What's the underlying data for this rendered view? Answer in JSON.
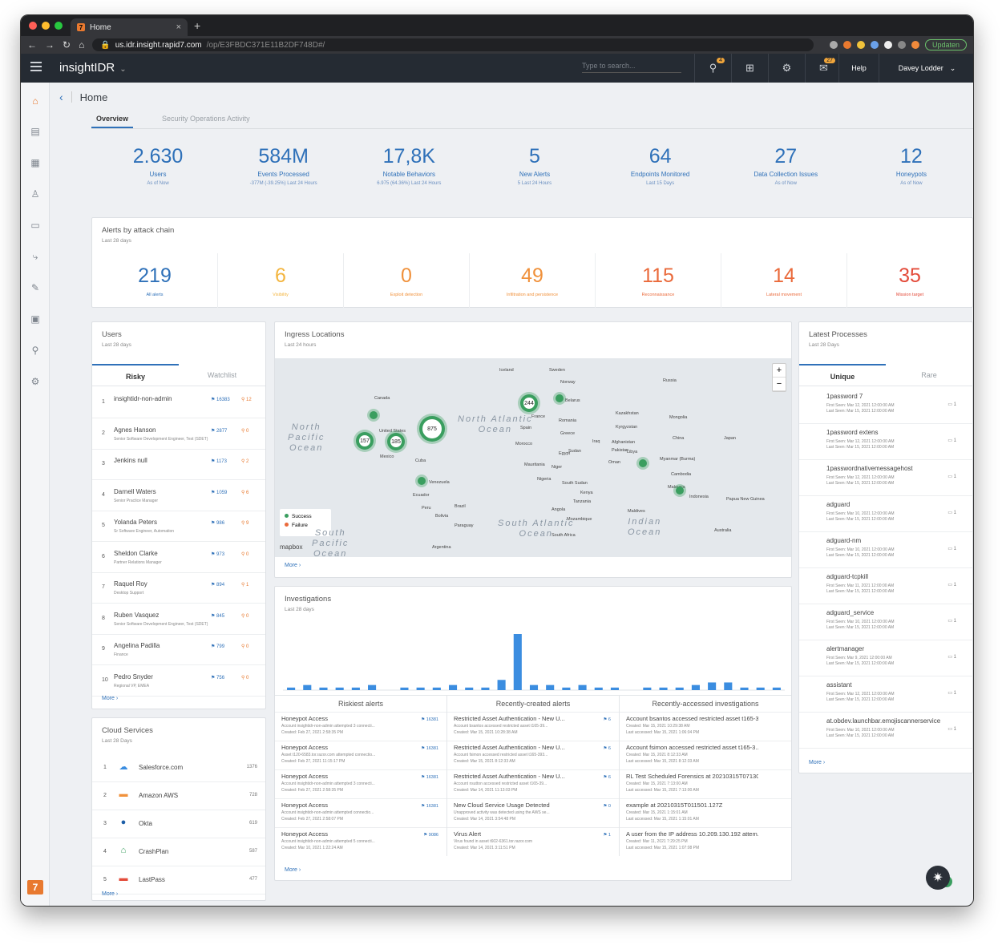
{
  "browser": {
    "tab_title": "Home",
    "url_host": "us.idr.insight.rapid7.com",
    "url_path": "/op/E3FBDC371E11B2DF748D#/",
    "update_label": "Updaten"
  },
  "header": {
    "brand": "insightIDR",
    "search_placeholder": "Type to search...",
    "alerts_badge": "4",
    "messages_badge": "27",
    "help": "Help",
    "user": "Davey Lodder"
  },
  "page": {
    "breadcrumb": "Home",
    "tabs": [
      "Overview",
      "Security Operations Activity"
    ]
  },
  "stats": [
    {
      "value": "2.630",
      "label": "Users",
      "sub": "As of Now"
    },
    {
      "value": "584M",
      "label": "Events Processed",
      "sub": "-377M (-39.25%)  Last 24 Hours"
    },
    {
      "value": "17,8K",
      "label": "Notable Behaviors",
      "sub": "6.975 (64.36%)  Last 24 Hours"
    },
    {
      "value": "5",
      "label": "New Alerts",
      "sub": "5  Last 24 Hours"
    },
    {
      "value": "64",
      "label": "Endpoints Monitored",
      "sub": "Last 15 Days"
    },
    {
      "value": "27",
      "label": "Data Collection Issues",
      "sub": "As of Now"
    },
    {
      "value": "12",
      "label": "Honeypots",
      "sub": "As of Now"
    }
  ],
  "alerts_chain": {
    "title": "Alerts by attack chain",
    "subtitle": "Last 28 days",
    "items": [
      {
        "value": "219",
        "label": "All alerts"
      },
      {
        "value": "6",
        "label": "Visibility"
      },
      {
        "value": "0",
        "label": "Exploit detection"
      },
      {
        "value": "49",
        "label": "Infiltration and persistence"
      },
      {
        "value": "115",
        "label": "Reconnaissance"
      },
      {
        "value": "14",
        "label": "Lateral movement"
      },
      {
        "value": "35",
        "label": "Mission target"
      }
    ]
  },
  "users": {
    "title": "Users",
    "subtitle": "Last 28 days",
    "tabs": [
      "Risky",
      "Watchlist"
    ],
    "rows": [
      {
        "n": "1",
        "name": "insightidr-non-admin",
        "role": "",
        "flags": "16383",
        "pins": "12"
      },
      {
        "n": "2",
        "name": "Agnes Hanson",
        "role": "Senior Software Development Engineer, Test (SDET)",
        "flags": "2877",
        "pins": "0"
      },
      {
        "n": "3",
        "name": "Jenkins null",
        "role": "",
        "flags": "1173",
        "pins": "2"
      },
      {
        "n": "4",
        "name": "Darnell Waters",
        "role": "Senior Practice Manager",
        "flags": "1059",
        "pins": "6"
      },
      {
        "n": "5",
        "name": "Yolanda Peters",
        "role": "Sr Software Engineer, Automation",
        "flags": "986",
        "pins": "9"
      },
      {
        "n": "6",
        "name": "Sheldon Clarke",
        "role": "Partner Relations Manager",
        "flags": "973",
        "pins": "0"
      },
      {
        "n": "7",
        "name": "Raquel Roy",
        "role": "Desktop Support",
        "flags": "894",
        "pins": "1"
      },
      {
        "n": "8",
        "name": "Ruben Vasquez",
        "role": "Senior Software Development Engineer, Test (SDET)",
        "flags": "845",
        "pins": "0"
      },
      {
        "n": "9",
        "name": "Angelina Padilla",
        "role": "Finance",
        "flags": "799",
        "pins": "0"
      },
      {
        "n": "10",
        "name": "Pedro Snyder",
        "role": "Regional VP, EMEA",
        "flags": "756",
        "pins": "0"
      }
    ],
    "more": "More"
  },
  "cloud": {
    "title": "Cloud Services",
    "subtitle": "Last 28 Days",
    "rows": [
      {
        "n": "1",
        "name": "Salesforce.com",
        "count": "1376"
      },
      {
        "n": "2",
        "name": "Amazon AWS",
        "count": "728"
      },
      {
        "n": "3",
        "name": "Okta",
        "count": "619"
      },
      {
        "n": "4",
        "name": "CrashPlan",
        "count": "587"
      },
      {
        "n": "5",
        "name": "LastPass",
        "count": "477"
      }
    ],
    "more": "More"
  },
  "ingress": {
    "title": "Ingress Locations",
    "subtitle": "Last 24 hours",
    "legend": [
      "Success",
      "Failure"
    ],
    "bubbles": [
      "875",
      "244",
      "185",
      "157"
    ],
    "oceans": [
      "North Pacific Ocean",
      "North Atlantic Ocean",
      "South Atlantic Ocean",
      "Indian Ocean",
      "South Pacific Ocean"
    ],
    "countries": [
      "Iceland",
      "Sweden",
      "Norway",
      "Russia",
      "Belarus",
      "France",
      "Romania",
      "Canada",
      "United States",
      "Mexico",
      "Cuba",
      "Spain",
      "Greece",
      "Kazakhstan",
      "Mongolia",
      "Kyrgyzstan",
      "China",
      "Japan",
      "Morocco",
      "Iraq",
      "Afghanistan",
      "Pakistan",
      "Libya",
      "Egypt",
      "Mauritania",
      "Niger",
      "Oman",
      "Myanmar (Burma)",
      "Nigeria",
      "Sudan",
      "South Sudan",
      "Cambodia",
      "Venezuela",
      "Ecuador",
      "Kenya",
      "Maldives",
      "Malaysia",
      "Indonesia",
      "Papua New Guinea",
      "Peru",
      "Brazil",
      "Tanzania",
      "Angola",
      "Bolivia",
      "Mozambique",
      "Paraguay",
      "South Africa",
      "Australia",
      "Argentina"
    ],
    "attribution": "mapbox",
    "more": "More"
  },
  "investigations": {
    "title": "Investigations",
    "subtitle": "Last 28 days",
    "columns": [
      "Riskiest alerts",
      "Recently-created alerts",
      "Recently-accessed investigations"
    ],
    "riskiest": [
      {
        "t": "Honeypot Access",
        "d1": "Account insightidr-non-admin attempted 3 connecti...",
        "d2": "Created: Feb 27, 2021 2:58:35 PM",
        "f": "16381"
      },
      {
        "t": "Honeypot Access",
        "d1": "Asset t120-6583.tor.razor.com attempted connectio...",
        "d2": "Created: Feb 27, 2021 11:15:17 PM",
        "f": "16381"
      },
      {
        "t": "Honeypot Access",
        "d1": "Account insightidr-non-admin attempted 3 connecti...",
        "d2": "Created: Feb 27, 2021 2:58:35 PM",
        "f": "16381"
      },
      {
        "t": "Honeypot Access",
        "d1": "Account insightidr-non-admin attempted connectio...",
        "d2": "Created: Feb 27, 2021 2:58:07 PM",
        "f": "16381"
      },
      {
        "t": "Honeypot Access",
        "d1": "Account insightidr-non-admin attempted 5 connecti...",
        "d2": "Created: Mar 10, 2021 1:22:24 AM",
        "f": "9086"
      }
    ],
    "recent": [
      {
        "t": "Restricted Asset Authentication - New U...",
        "d1": "Account bsantos accessed restricted asset t165-39...",
        "d2": "Created: Mar 15, 2021 10:28:38 AM",
        "f": "6"
      },
      {
        "t": "Restricted Asset Authentication - New U...",
        "d1": "Account fsimon accessed restricted asset t165-393...",
        "d2": "Created: Mar 15, 2021 8:12:33 AM",
        "f": "6"
      },
      {
        "t": "Restricted Asset Authentication - New U...",
        "d1": "Account nsutton accessed restricted asset t165-39...",
        "d2": "Created: Mar 14, 2021 11:13:03 PM",
        "f": "6"
      },
      {
        "t": "New Cloud Service Usage Detected",
        "d1": "Unapproved activity was detected using the AWS se...",
        "d2": "Created: Mar 14, 2021 3:54:48 PM",
        "f": "0"
      },
      {
        "t": "Virus Alert",
        "d1": "Virus found in asset t602-6361.tor.razor.com",
        "d2": "Created: Mar 14, 2021 3:11:51 PM",
        "f": "1"
      }
    ],
    "accessed": [
      {
        "t": "Account bsantos accessed restricted asset t165-3...",
        "d1": "Created: Mar 15, 2021 10:29:38 AM",
        "d2": "Last accessed: Mar 15, 2021 1:06:04 PM"
      },
      {
        "t": "Account fsimon accessed restricted asset t165-3...",
        "d1": "Created: Mar 15, 2021 8:12:33 AM",
        "d2": "Last accessed: Mar 15, 2021 8:12:33 AM"
      },
      {
        "t": "RL Test Scheduled Forensics at 20210315T07130...",
        "d1": "Created: Mar 15, 2021 7:13:00 AM",
        "d2": "Last accessed: Mar 15, 2021 7:13:00 AM"
      },
      {
        "t": "example at 20210315T011501.127Z",
        "d1": "Created: Mar 15, 2021 1:15:01 AM",
        "d2": "Last accessed: Mar 15, 2021 1:15:01 AM"
      },
      {
        "t": "A user from the IP address 10.209.130.192 attem...",
        "d1": "Created: Mar 11, 2021 7:29:25 PM",
        "d2": "Last accessed: Mar 15, 2021 1:07:08 PM"
      }
    ],
    "more": "More"
  },
  "chart_data": {
    "type": "bar",
    "values": [
      1,
      2,
      1,
      1,
      1,
      2,
      0,
      1,
      1,
      1,
      2,
      1,
      1,
      4,
      22,
      2,
      2,
      1,
      2,
      1,
      1,
      0,
      1,
      1,
      1,
      2,
      3,
      3,
      1,
      1,
      1
    ],
    "color": "#3b8de0"
  },
  "processes": {
    "title": "Latest Processes",
    "subtitle": "Last 28 Days",
    "tabs": [
      "Unique",
      "Rare"
    ],
    "rows": [
      {
        "name": "1password 7",
        "first": "First Seen: Mar 12, 2021 12:00:00 AM",
        "last": "Last Seen: Mar 15, 2021 12:00:00 AM",
        "c": "1"
      },
      {
        "name": "1password extens",
        "first": "First Seen: Mar 12, 2021 12:00:00 AM",
        "last": "Last Seen: Mar 15, 2021 12:00:00 AM",
        "c": "1"
      },
      {
        "name": "1passwordnativemessagehost",
        "first": "First Seen: Mar 12, 2021 12:00:00 AM",
        "last": "Last Seen: Mar 15, 2021 12:00:00 AM",
        "c": "1"
      },
      {
        "name": "adguard",
        "first": "First Seen: Mar 10, 2021 12:00:00 AM",
        "last": "Last Seen: Mar 15, 2021 12:00:00 AM",
        "c": "1"
      },
      {
        "name": "adguard-nm",
        "first": "First Seen: Mar 10, 2021 12:00:00 AM",
        "last": "Last Seen: Mar 15, 2021 12:00:00 AM",
        "c": "1"
      },
      {
        "name": "adguard-tcpkill",
        "first": "First Seen: Mar 11, 2021 12:00:00 AM",
        "last": "Last Seen: Mar 15, 2021 12:00:00 AM",
        "c": "1"
      },
      {
        "name": "adguard_service",
        "first": "First Seen: Mar 10, 2021 12:00:00 AM",
        "last": "Last Seen: Mar 15, 2021 12:00:00 AM",
        "c": "1"
      },
      {
        "name": "alertmanager",
        "first": "First Seen: Mar 9, 2021 12:00:00 AM",
        "last": "Last Seen: Mar 15, 2021 12:00:00 AM",
        "c": "1"
      },
      {
        "name": "assistant",
        "first": "First Seen: Mar 12, 2021 12:00:00 AM",
        "last": "Last Seen: Mar 15, 2021 12:00:00 AM",
        "c": "1"
      },
      {
        "name": "at.obdev.launchbar.emojiscannerservice",
        "first": "First Seen: Mar 10, 2021 12:00:00 AM",
        "last": "Last Seen: Mar 15, 2021 12:00:00 AM",
        "c": "1"
      }
    ],
    "more": "More"
  },
  "fab_badge": "5"
}
